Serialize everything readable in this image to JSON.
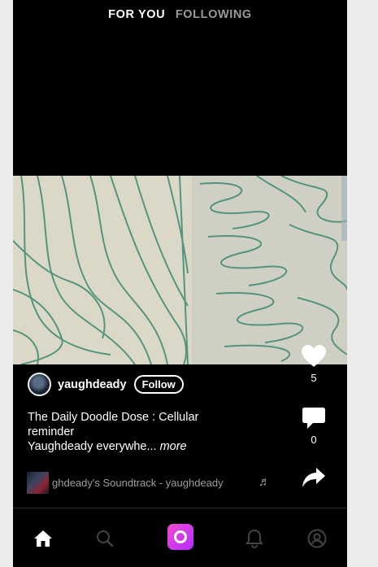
{
  "header": {
    "tabs": [
      {
        "label": "FOR YOU",
        "active": true
      },
      {
        "label": "FOLLOWING",
        "active": false
      }
    ]
  },
  "post": {
    "username": "yaughdeady",
    "follow_label": "Follow",
    "caption_line1": "The Daily Doodle Dose : Cellular",
    "caption_line2": "reminder",
    "caption_line3": "Yaughdeady everywhe...",
    "more_label": "more",
    "likes": "5",
    "comments": "0",
    "sound": "ghdeady's Soundtrack - yaughdeady"
  },
  "icons": {
    "like": "heart-icon",
    "comment": "comment-icon",
    "share": "share-icon",
    "note": "music-note-icon"
  },
  "nav": [
    {
      "name": "home-icon",
      "active": true
    },
    {
      "name": "search-icon",
      "active": false
    },
    {
      "name": "camera-icon",
      "active": false
    },
    {
      "name": "bell-icon",
      "active": false
    },
    {
      "name": "profile-icon",
      "active": false
    }
  ],
  "colors": {
    "background": "#000000",
    "accent": "#d63bf0",
    "muted_text": "#9d9d9d"
  }
}
